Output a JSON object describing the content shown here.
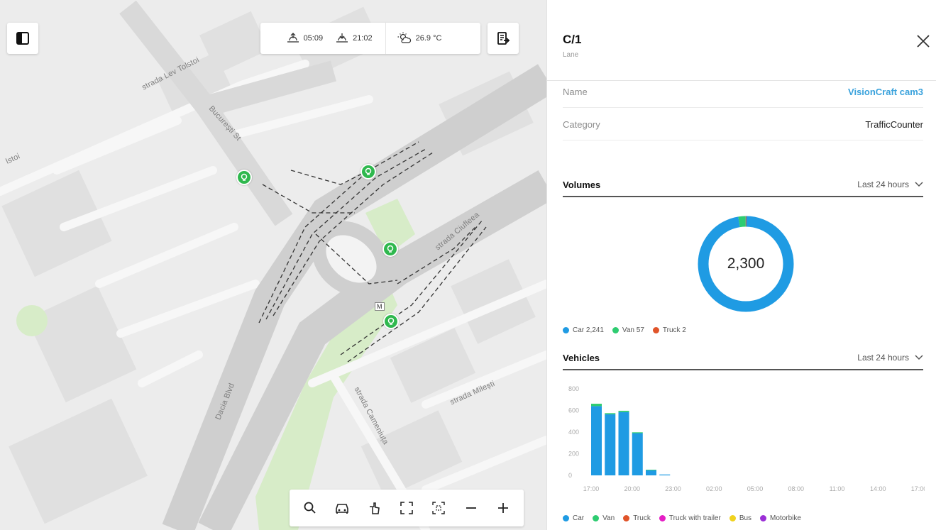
{
  "map": {
    "top_bar": {
      "sunrise": "05:09",
      "sunset": "21:02",
      "temperature": "26.9 °C",
      "sunrise_icon": "sunrise-icon",
      "sunset_icon": "sunset-icon",
      "weather_icon": "partly-cloudy-icon"
    },
    "street_labels": {
      "lev_tolstoi": "strada Lev Tolstoi",
      "tolstoi_left": "lstoi",
      "bucuresti": "București St",
      "ciufleea": "strada Ciufleea",
      "dacia": "Dacia Blvd",
      "milesti": "strada Milești",
      "cameniuța": "strada Cameniuța",
      "road_shield": "M"
    },
    "toolbar": [
      "search",
      "traffic",
      "pointer",
      "fullscreen",
      "fit-bounds",
      "zoom-out",
      "zoom-in"
    ]
  },
  "panel": {
    "title": "C/1",
    "subtitle": "Lane",
    "properties": [
      {
        "key": "Name",
        "value": "VisionCraft cam3",
        "link": true
      },
      {
        "key": "Category",
        "value": "TrafficCounter",
        "link": false
      }
    ],
    "volumes": {
      "heading": "Volumes",
      "range": "Last 24 hours",
      "total": "2,300",
      "legend": [
        {
          "label": "Car 2,241",
          "color": "#1f9be3",
          "value": 2241
        },
        {
          "label": "Van 57",
          "color": "#2ecc71",
          "value": 57
        },
        {
          "label": "Truck 2",
          "color": "#e0542a",
          "value": 2
        }
      ]
    },
    "vehicles": {
      "heading": "Vehicles",
      "range": "Last 24 hours",
      "legend": [
        {
          "label": "Car",
          "color": "#1f9be3"
        },
        {
          "label": "Van",
          "color": "#2ecc71"
        },
        {
          "label": "Truck",
          "color": "#e0542a"
        },
        {
          "label": "Truck with trailer",
          "color": "#e51fc5"
        },
        {
          "label": "Bus",
          "color": "#f0d21e"
        },
        {
          "label": "Motorbike",
          "color": "#9b2fd6"
        }
      ]
    }
  },
  "chart_data": {
    "type": "bar",
    "categories": [
      "17:00",
      "18:00",
      "19:00",
      "20:00",
      "21:00",
      "22:00",
      "23:00",
      "00:00",
      "01:00",
      "02:00",
      "03:00",
      "04:00",
      "05:00",
      "06:00",
      "07:00",
      "08:00",
      "09:00",
      "10:00",
      "11:00",
      "12:00",
      "13:00",
      "14:00",
      "15:00",
      "16:00",
      "17:00"
    ],
    "tick_labels": [
      "17:00",
      "20:00",
      "23:00",
      "02:00",
      "05:00",
      "08:00",
      "11:00",
      "14:00",
      "17:00"
    ],
    "series": [
      {
        "name": "Car",
        "color": "#1f9be3",
        "values": [
          640,
          565,
          585,
          390,
          50,
          8,
          0,
          0,
          0,
          0,
          0,
          0,
          0,
          0,
          0,
          0,
          0,
          0,
          0,
          0,
          0,
          0,
          0,
          0,
          0
        ]
      },
      {
        "name": "Van",
        "color": "#2ecc71",
        "values": [
          22,
          10,
          12,
          8,
          2,
          0,
          0,
          0,
          0,
          0,
          0,
          0,
          0,
          0,
          0,
          0,
          0,
          0,
          0,
          0,
          0,
          0,
          0,
          0,
          0
        ]
      }
    ],
    "y_ticks": [
      0,
      200,
      400,
      600,
      800
    ],
    "ylim": [
      0,
      800
    ],
    "stacked": true,
    "grid": false
  }
}
